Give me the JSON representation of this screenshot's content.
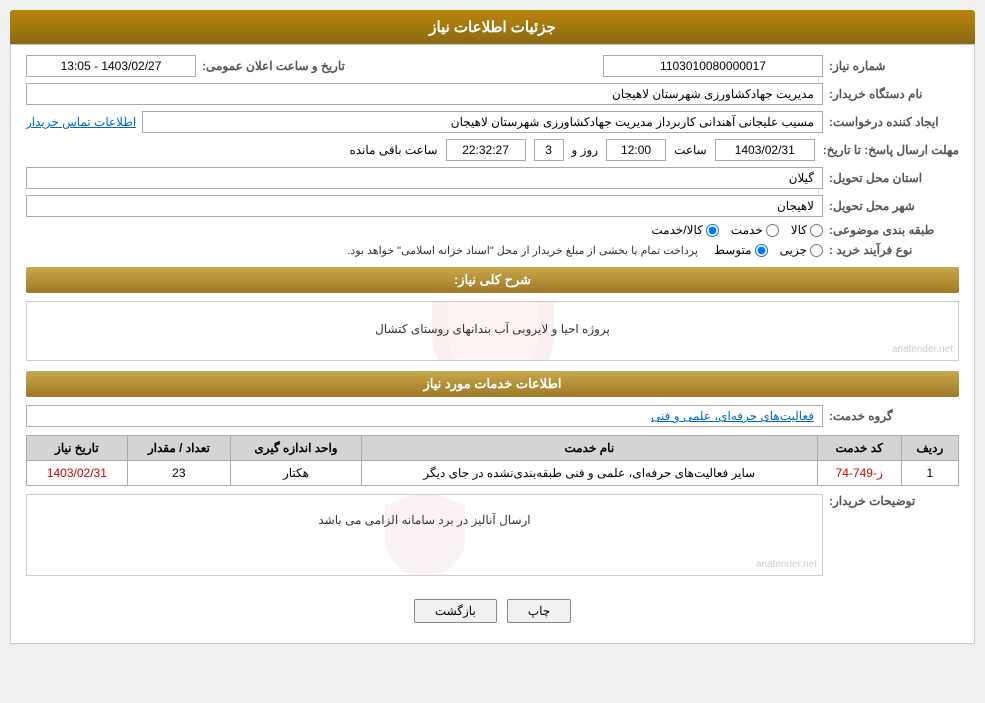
{
  "page": {
    "title": "جزئیات اطلاعات نیاز",
    "section1": "جزئیات اطلاعات نیاز",
    "section2": "اطلاعات خدمات مورد نیاز"
  },
  "labels": {
    "niaaz_number": "شماره نیاز:",
    "buyer_org": "نام دستگاه خریدار:",
    "requester": "ایجاد کننده درخواست:",
    "deadline": "مهلت ارسال پاسخ: تا تاریخ:",
    "province": "استان محل تحویل:",
    "city": "شهر محل تحویل:",
    "category": "طبقه بندی موضوعی:",
    "purchase_type": "نوع فرآیند خرید :",
    "general_desc": "شرح کلی نیاز:",
    "service_group": "گروه خدمت:",
    "buyer_notes": "توضیحات خریدار:",
    "contact_info": "اطلاعات تماس خریدار",
    "announce_time": "تاریخ و ساعت اعلان عمومی:",
    "remaining": "ساعت باقی مانده"
  },
  "values": {
    "niaaz_number": "1103010080000017",
    "buyer_org": "مدیریت جهادکشاورزی شهرستان لاهیجان",
    "requester": "مسیب علیجانی آهندانی کاربرداز مدیریت جهادکشاورزی شهرستان لاهیجان",
    "announce_date": "1403/02/27 - 13:05",
    "deadline_date": "1403/02/31",
    "deadline_time": "12:00",
    "deadline_days": "3",
    "deadline_remaining": "22:32:27",
    "province": "گیلان",
    "city": "لاهیجان",
    "category_kala": "کالا",
    "category_khadamat": "خدمت",
    "category_kala_khadamat": "کالا/خدمت",
    "purchase_jozii": "جزیی",
    "purchase_motavaset": "متوسط",
    "purchase_desc": "پرداخت تمام یا بخشی از مبلغ خریدار از محل \"اسناد خزانه اسلامی\" خواهد بود.",
    "general_desc_text": "پروژه احیا و لایروبی آب بندانهای روستای کتشال",
    "service_group_text": "فعالیت‌های حرفه‌ای، علمی و فنی",
    "buyer_notes_text": "ارسال آنالیز در برد سامانه الزامی می باشد"
  },
  "table": {
    "headers": [
      "ردیف",
      "کد خدمت",
      "نام خدمت",
      "واحد اندازه گیری",
      "تعداد / مقدار",
      "تاریخ نیاز"
    ],
    "rows": [
      {
        "row": "1",
        "code": "ز-749-74",
        "name": "سایر فعالیت‌های حرفه‌ای، علمی و فنی طبقه‌بندی‌نشده در جای دیگر",
        "unit": "هکتار",
        "count": "23",
        "date": "1403/02/31"
      }
    ]
  },
  "buttons": {
    "print": "چاپ",
    "back": "بازگشت"
  }
}
